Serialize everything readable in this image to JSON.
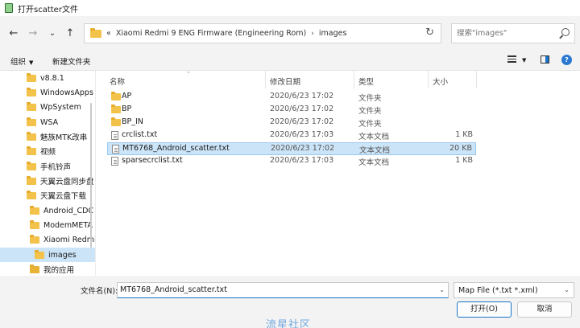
{
  "window": {
    "title": "打开scatter文件"
  },
  "nav": {
    "back_glyph": "←",
    "forward_glyph": "→",
    "recent_glyph": "⌄",
    "up_glyph": "↑",
    "breadcrumb": [
      "«",
      "Xiaomi Redmi 9 ENG Firmware (Engineering Rom)",
      "›",
      "images"
    ],
    "refresh_glyph": "↻",
    "search_placeholder": "搜索\"images\""
  },
  "toolbar": {
    "organize": "组织",
    "new_folder": "新建文件夹"
  },
  "sidebar": {
    "items": [
      {
        "label": "v8.8.1",
        "indent": 1
      },
      {
        "label": "WindowsApps",
        "indent": 1
      },
      {
        "label": "WpSystem",
        "indent": 1
      },
      {
        "label": "WSA",
        "indent": 1
      },
      {
        "label": "魅族MTK改串",
        "indent": 1
      },
      {
        "label": "视频",
        "indent": 1
      },
      {
        "label": "手机铃声",
        "indent": 1
      },
      {
        "label": "天翼云盘同步盘",
        "indent": 1
      },
      {
        "label": "天翼云盘下载",
        "indent": 1
      },
      {
        "label": "Android_CDC",
        "indent": 2
      },
      {
        "label": "ModemMETA",
        "indent": 2
      },
      {
        "label": "Xiaomi Redmi",
        "indent": 2
      },
      {
        "label": "images",
        "indent": 3,
        "selected": true
      },
      {
        "label": "我的应用",
        "indent": 2
      }
    ]
  },
  "columns": {
    "name": "名称",
    "date": "修改日期",
    "type": "类型",
    "size": "大小"
  },
  "files": [
    {
      "name": "AP",
      "date": "2020/6/23 17:02",
      "type": "文件夹",
      "size": "",
      "kind": "folder"
    },
    {
      "name": "BP",
      "date": "2020/6/23 17:02",
      "type": "文件夹",
      "size": "",
      "kind": "folder"
    },
    {
      "name": "BP_IN",
      "date": "2020/6/23 17:02",
      "type": "文件夹",
      "size": "",
      "kind": "folder"
    },
    {
      "name": "crclist.txt",
      "date": "2020/6/23 17:03",
      "type": "文本文档",
      "size": "1 KB",
      "kind": "doc"
    },
    {
      "name": "MT6768_Android_scatter.txt",
      "date": "2020/6/23 17:02",
      "type": "文本文档",
      "size": "20 KB",
      "kind": "doc",
      "selected": true
    },
    {
      "name": "sparsecrclist.txt",
      "date": "2020/6/23 17:03",
      "type": "文本文档",
      "size": "1 KB",
      "kind": "doc"
    }
  ],
  "footer": {
    "filename_label": "文件名(N):",
    "filename_value": "MT6768_Android_scatter.txt",
    "filter": "Map File (*.txt *.xml)",
    "open": "打开(O)",
    "cancel": "取消",
    "watermark": "流星社区"
  },
  "colors": {
    "accent": "#1a73c8",
    "selection": "#cce4f7",
    "folder": "#f3c24a"
  }
}
